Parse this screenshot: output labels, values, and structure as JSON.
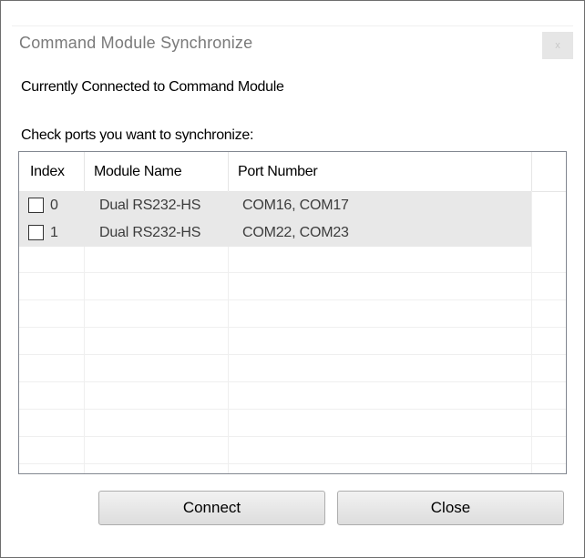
{
  "window": {
    "title": "Command Module Synchronize",
    "close_glyph": "x"
  },
  "status": {
    "text": "Currently Connected to Command Module"
  },
  "instructions": {
    "text": "Check ports you want to synchronize:"
  },
  "ports_table": {
    "columns": [
      "Index",
      "Module Name",
      "Port Number"
    ],
    "rows": [
      {
        "checked": false,
        "index": "0",
        "module": "Dual RS232-HS",
        "ports": "COM16, COM17"
      },
      {
        "checked": false,
        "index": "1",
        "module": "Dual RS232-HS",
        "ports": "COM22, COM23"
      }
    ]
  },
  "buttons": {
    "connect": "Connect",
    "close": "Close"
  }
}
